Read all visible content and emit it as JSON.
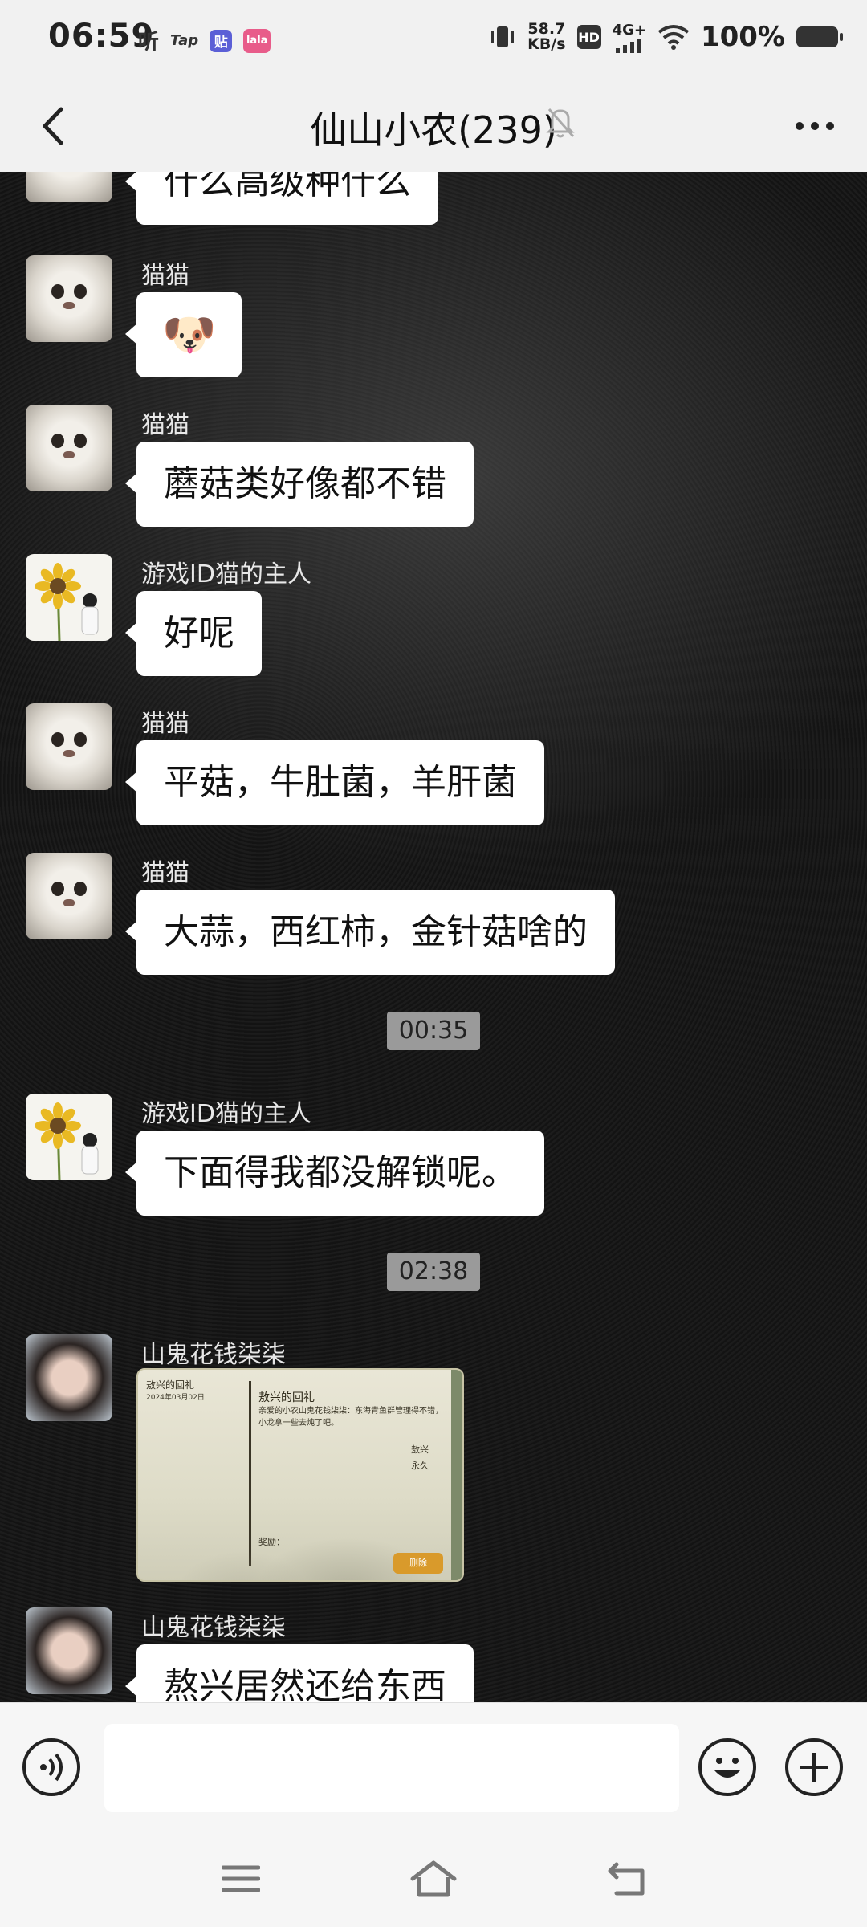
{
  "status_bar": {
    "time": "06:59",
    "apps": [
      "听",
      "Tap",
      "贴",
      "lala"
    ],
    "net_speed_value": "58.7",
    "net_speed_unit": "KB/s",
    "hd": "HD",
    "network": "4G+",
    "battery": "100%"
  },
  "header": {
    "title": "仙山小农(239)"
  },
  "messages": [
    {
      "type": "text",
      "sender": "",
      "text": "什么高级种什么",
      "avatar": "cat"
    },
    {
      "type": "sticker",
      "sender": "猫猫",
      "text": "🐶",
      "avatar": "cat"
    },
    {
      "type": "text",
      "sender": "猫猫",
      "text": "蘑菇类好像都不错",
      "avatar": "cat"
    },
    {
      "type": "text",
      "sender": "游戏ID猫的主人",
      "text": "好呢",
      "avatar": "sunflower"
    },
    {
      "type": "text",
      "sender": "猫猫",
      "text": "平菇，牛肚菌，羊肝菌",
      "avatar": "cat"
    },
    {
      "type": "text",
      "sender": "猫猫",
      "text": "大蒜，西红柿，金针菇啥的",
      "avatar": "cat"
    },
    {
      "type": "time",
      "text": "00:35"
    },
    {
      "type": "text",
      "sender": "游戏ID猫的主人",
      "text": "下面得我都没解锁呢。",
      "avatar": "sunflower"
    },
    {
      "type": "time",
      "text": "02:38"
    },
    {
      "type": "image",
      "sender": "山鬼花钱柒柒",
      "avatar": "girl"
    },
    {
      "type": "text",
      "sender": "山鬼花钱柒柒",
      "text": "熬兴居然还给东西",
      "avatar": "girl"
    }
  ],
  "image_card": {
    "left_title": "敖兴的回礼",
    "left_date": "2024年03月02日",
    "title": "敖兴的回礼",
    "body": "亲爱的小农山鬼花钱柒柒：东海青鱼群管理得不错，小龙拿一些去炖了吧。",
    "sign_1": "敖兴",
    "sign_2": "永久",
    "reward_label": "奖励：",
    "button": "删除"
  },
  "input": {
    "placeholder": ""
  },
  "icons": {
    "back": "back-arrow-icon",
    "mute": "bell-off-icon",
    "more": "more-dots-icon",
    "voice": "voice-icon",
    "emoji": "smiley-icon",
    "plus": "plus-icon",
    "menu": "menu-icon",
    "home": "home-icon",
    "return": "return-icon"
  }
}
